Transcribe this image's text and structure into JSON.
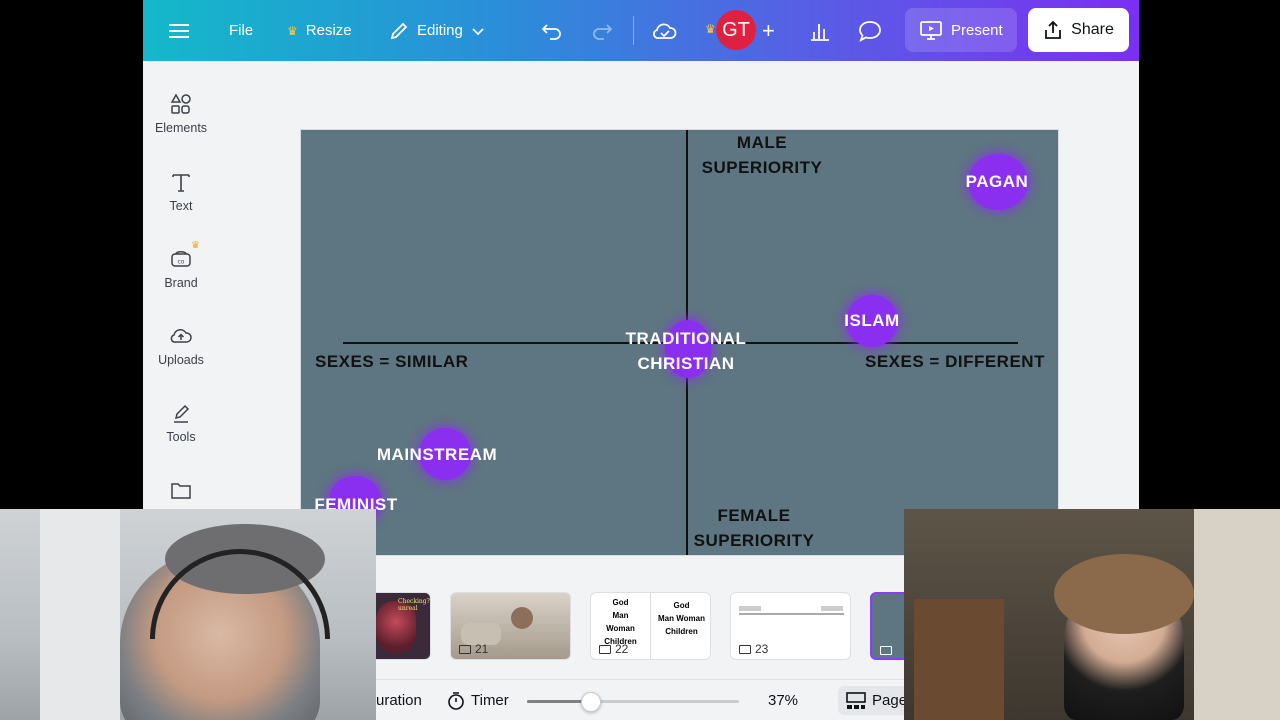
{
  "topbar": {
    "file_label": "File",
    "resize_label": "Resize",
    "editing_label": "Editing",
    "avatar_initials": "GT",
    "present_label": "Present",
    "share_label": "Share"
  },
  "rail": {
    "items": [
      {
        "label": "Elements",
        "icon": "elements-icon"
      },
      {
        "label": "Text",
        "icon": "text-icon"
      },
      {
        "label": "Brand",
        "icon": "brand-icon"
      },
      {
        "label": "Uploads",
        "icon": "uploads-icon"
      },
      {
        "label": "Tools",
        "icon": "tools-icon"
      }
    ]
  },
  "slide": {
    "background": "#5e7681",
    "accent": "#8a2ef0",
    "axis_top": [
      "MALE",
      "SUPERIORITY"
    ],
    "axis_bottom": [
      "FEMALE",
      "SUPERIORITY"
    ],
    "axis_left": "SEXES = SIMILAR",
    "axis_right": "SEXES = DIFFERENT",
    "points": {
      "pagan": "PAGAN",
      "islam": "ISLAM",
      "traditional": [
        "TRADITIONAL",
        "CHRISTIAN"
      ],
      "mainstream": "MAINSTREAM",
      "feminist": "FEMINIST"
    }
  },
  "strip": {
    "thumbs": [
      {
        "num": "21"
      },
      {
        "num": "22",
        "left_text": [
          "God",
          "Man",
          "Woman",
          "Children"
        ],
        "right_text": [
          "God",
          "Man",
          "Woman",
          "Children"
        ]
      },
      {
        "num": "23"
      }
    ],
    "thumb_partial_text": "Checking? unreal"
  },
  "footer": {
    "duration_label": "uration",
    "timer_label": "Timer",
    "zoom_value": "37%",
    "zoom_fraction": 0.37,
    "pages_label": "Page"
  }
}
